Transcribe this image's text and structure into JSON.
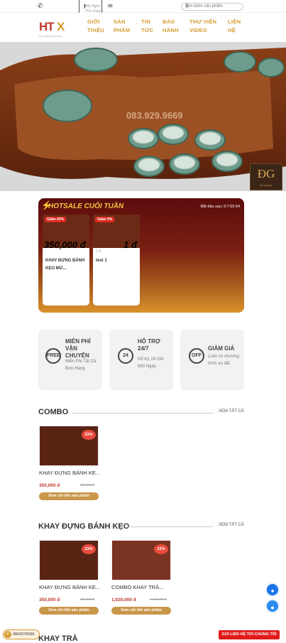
{
  "topbar": {
    "phone_icon": "phone-icon",
    "facebook_text": "My Nghe Phu Xuyen",
    "mail_icon": "mail-icon",
    "search_placeholder": "Tìm kiếm sản phẩm"
  },
  "logo": {
    "part1": "HT",
    "part2": "X",
    "tagline": "MỸ NGHỆ GỖ HƯƠNG"
  },
  "nav": [
    {
      "line1": "GIỚI",
      "line2": "THIỆU"
    },
    {
      "line1": "SẢN",
      "line2": "PHẨM"
    },
    {
      "line1": "TIN",
      "line2": "TỨC"
    },
    {
      "line1": "BẢO",
      "line2": "HÀNH"
    },
    {
      "line1": "THƯ VIỆN",
      "line2": "VIDEO"
    },
    {
      "line1": "LIÊN",
      "line2": "HỆ"
    }
  ],
  "hero": {
    "watermark": "083.929.9669",
    "badge": "ĐG",
    "badge_small": "ĐỒ GỖ ĐẸP"
  },
  "hotsale": {
    "title": "HOTSALE CUỐI TUẦN",
    "countdown_label": "Bắt đầu sau:",
    "countdown": "6:7:55:54",
    "items": [
      {
        "badge": "Giảm 42%",
        "price": "350,000 đ",
        "old_price": "",
        "name": "KHAY ĐỰNG BÁNH KẸO MỨ..."
      },
      {
        "badge": "Giảm 0%",
        "price": "1 đ",
        "old_price": "1 đ",
        "name": "test 1"
      }
    ]
  },
  "features": [
    {
      "title": "MIỄN PHÍ VẬN CHUYỂN",
      "desc": "Miễn Phí Tất Cả Đơn Hàng",
      "icon": "FREE"
    },
    {
      "title": "HỖ TRỢ 24/7",
      "desc": "Hỗ trợ 24 Giờ Một Ngày",
      "icon": "24"
    },
    {
      "title": "GIẢM GIÁ",
      "desc": "Luôn có chương trình ưu đãi",
      "icon": "OFF"
    }
  ],
  "sections": {
    "combo": {
      "title": "COMBO",
      "see_all": "XEM TẤT CẢ",
      "products": [
        {
          "name": "KHAY ĐỰNG BÁNH KE...",
          "price": "350,000 đ",
          "old_price": "600,000 đ",
          "discount": "23%",
          "button": "Xem chi tiết sản phẩm"
        }
      ]
    },
    "khay": {
      "title": "KHAY ĐỰNG BÁNH KẸO",
      "see_all": "XEM TẤT CẢ",
      "products": [
        {
          "name": "KHAY ĐỰNG BÁNH KE...",
          "price": "350,000 đ",
          "old_price": "600,000 đ",
          "discount": "23%",
          "button": "Xem chi tiết sản phẩm"
        },
        {
          "name": "COMBO KHAY TRÀ...",
          "price": "1,020,000 đ",
          "old_price": "1,400,000 đ",
          "discount": "23%",
          "button": "Xem chi tiết sản phẩm"
        }
      ]
    },
    "khaytra": {
      "title": "KHAY TRÀ"
    }
  },
  "floating": {
    "hotline": "0862076096",
    "contact_button": "GỬI LIÊN HỆ TỚI CHÚNG TÔI"
  },
  "colors": {
    "accent": "#d39a2c",
    "red": "#c0392b",
    "hot_bg": "#5b0d0d"
  }
}
